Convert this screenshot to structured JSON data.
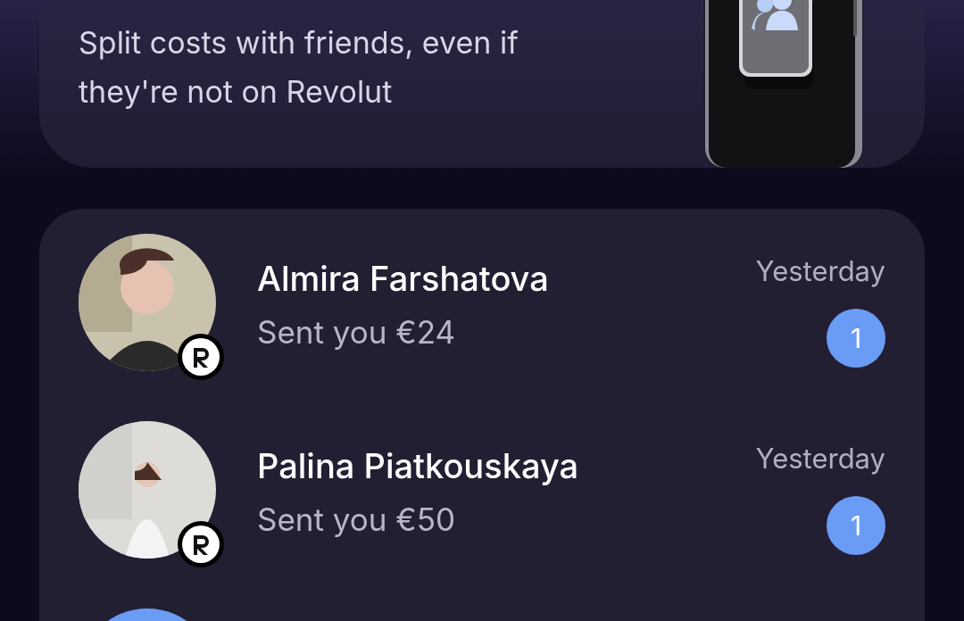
{
  "promo_card": {
    "description": "Split costs with friends, even if they're not on Revolut"
  },
  "contacts": [
    {
      "name": "Almira Farshatova",
      "message": "Sent you €24",
      "time": "Yesterday",
      "unread": "1"
    },
    {
      "name": "Palina Piatkouskaya",
      "message": "Sent you €50",
      "time": "Yesterday",
      "unread": "1"
    },
    {
      "avatar": {
        "kind": "initials",
        "color": "#6b9cf5"
      }
    }
  ]
}
